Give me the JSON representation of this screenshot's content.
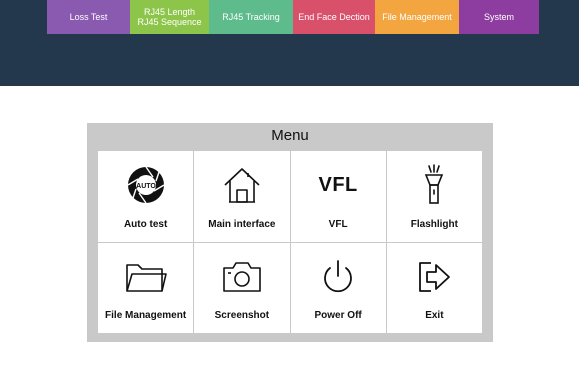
{
  "top_tabs": [
    {
      "lines": [
        "Loss Test"
      ],
      "color": "#8a5ab1"
    },
    {
      "lines": [
        "RJ45 Length",
        "RJ45 Sequence"
      ],
      "color": "#8dc54a"
    },
    {
      "lines": [
        "RJ45 Tracking"
      ],
      "color": "#5dbb8c"
    },
    {
      "lines": [
        "End Face Dection"
      ],
      "color": "#d9506a"
    },
    {
      "lines": [
        "File Management"
      ],
      "color": "#f3a640"
    },
    {
      "lines": [
        "System"
      ],
      "color": "#8d3da0"
    }
  ],
  "menu": {
    "title": "Menu",
    "items": [
      {
        "label": "Auto test",
        "icon": "auto-camera-icon",
        "icon_text": "AUTO"
      },
      {
        "label": "Main interface",
        "icon": "home-icon"
      },
      {
        "label": "VFL",
        "icon": "vfl-icon",
        "icon_text": "VFL"
      },
      {
        "label": "Flashlight",
        "icon": "flashlight-icon"
      },
      {
        "label": "File Management",
        "icon": "folder-icon"
      },
      {
        "label": "Screenshot",
        "icon": "camera-icon"
      },
      {
        "label": "Power Off",
        "icon": "power-icon"
      },
      {
        "label": "Exit",
        "icon": "exit-icon"
      }
    ]
  },
  "colors": {
    "top_panel": "#23384d",
    "menu_panel": "#c9c9c9"
  }
}
